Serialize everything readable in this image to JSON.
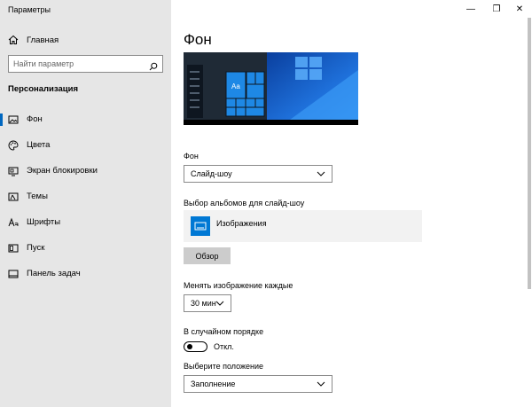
{
  "app": {
    "title": "Параметры"
  },
  "window_controls": {
    "minimize": "—",
    "maximize": "❐",
    "close": "✕"
  },
  "sidebar": {
    "home_label": "Главная",
    "search_placeholder": "Найти параметр",
    "section_title": "Персонализация",
    "items": [
      {
        "label": "Фон",
        "icon": "picture-icon",
        "active": true
      },
      {
        "label": "Цвета",
        "icon": "palette-icon",
        "active": false
      },
      {
        "label": "Экран блокировки",
        "icon": "lock-screen-icon",
        "active": false
      },
      {
        "label": "Темы",
        "icon": "themes-icon",
        "active": false
      },
      {
        "label": "Шрифты",
        "icon": "font-icon",
        "active": false
      },
      {
        "label": "Пуск",
        "icon": "start-icon",
        "active": false
      },
      {
        "label": "Панель задач",
        "icon": "taskbar-icon",
        "active": false
      }
    ]
  },
  "main": {
    "title": "Фон",
    "preview_sample_text": "Aa",
    "background_label": "Фон",
    "background_value": "Слайд-шоу",
    "albums_label": "Выбор альбомов для слайд-шоу",
    "album_name": "Изображения",
    "browse_button": "Обзор",
    "interval_label": "Менять изображение каждые",
    "interval_value": "30 мин",
    "shuffle_label": "В случайном порядке",
    "shuffle_state": "Откл.",
    "fit_label": "Выберите положение",
    "fit_value": "Заполнение"
  },
  "colors": {
    "accent": "#0078d4",
    "sidebar_bg": "#e6e6e6"
  }
}
